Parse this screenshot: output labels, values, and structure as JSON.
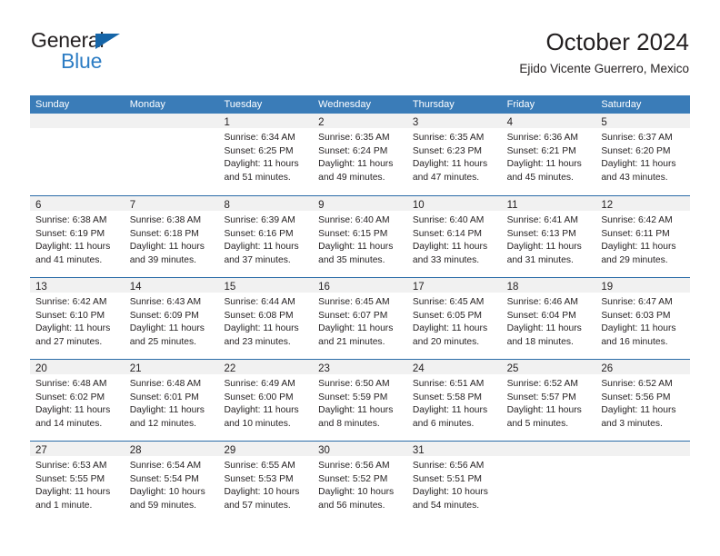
{
  "brand": {
    "name_part1": "General",
    "name_part2": "Blue",
    "triangle_color": "#1565a8",
    "blue_color": "#2d7dc4"
  },
  "header": {
    "title": "October 2024",
    "subtitle": "Ejido Vicente Guerrero, Mexico"
  },
  "theme": {
    "header_blue": "#3a7cb8",
    "row_divider": "#2a6ca8",
    "day_band_gray": "#f1f1f1",
    "text": "#231f20"
  },
  "weekdays": [
    "Sunday",
    "Monday",
    "Tuesday",
    "Wednesday",
    "Thursday",
    "Friday",
    "Saturday"
  ],
  "weeks": [
    [
      {
        "empty": true
      },
      {
        "empty": true
      },
      {
        "day": "1",
        "sunrise": "Sunrise: 6:34 AM",
        "sunset": "Sunset: 6:25 PM",
        "daylight1": "Daylight: 11 hours",
        "daylight2": "and 51 minutes."
      },
      {
        "day": "2",
        "sunrise": "Sunrise: 6:35 AM",
        "sunset": "Sunset: 6:24 PM",
        "daylight1": "Daylight: 11 hours",
        "daylight2": "and 49 minutes."
      },
      {
        "day": "3",
        "sunrise": "Sunrise: 6:35 AM",
        "sunset": "Sunset: 6:23 PM",
        "daylight1": "Daylight: 11 hours",
        "daylight2": "and 47 minutes."
      },
      {
        "day": "4",
        "sunrise": "Sunrise: 6:36 AM",
        "sunset": "Sunset: 6:21 PM",
        "daylight1": "Daylight: 11 hours",
        "daylight2": "and 45 minutes."
      },
      {
        "day": "5",
        "sunrise": "Sunrise: 6:37 AM",
        "sunset": "Sunset: 6:20 PM",
        "daylight1": "Daylight: 11 hours",
        "daylight2": "and 43 minutes."
      }
    ],
    [
      {
        "day": "6",
        "sunrise": "Sunrise: 6:38 AM",
        "sunset": "Sunset: 6:19 PM",
        "daylight1": "Daylight: 11 hours",
        "daylight2": "and 41 minutes."
      },
      {
        "day": "7",
        "sunrise": "Sunrise: 6:38 AM",
        "sunset": "Sunset: 6:18 PM",
        "daylight1": "Daylight: 11 hours",
        "daylight2": "and 39 minutes."
      },
      {
        "day": "8",
        "sunrise": "Sunrise: 6:39 AM",
        "sunset": "Sunset: 6:16 PM",
        "daylight1": "Daylight: 11 hours",
        "daylight2": "and 37 minutes."
      },
      {
        "day": "9",
        "sunrise": "Sunrise: 6:40 AM",
        "sunset": "Sunset: 6:15 PM",
        "daylight1": "Daylight: 11 hours",
        "daylight2": "and 35 minutes."
      },
      {
        "day": "10",
        "sunrise": "Sunrise: 6:40 AM",
        "sunset": "Sunset: 6:14 PM",
        "daylight1": "Daylight: 11 hours",
        "daylight2": "and 33 minutes."
      },
      {
        "day": "11",
        "sunrise": "Sunrise: 6:41 AM",
        "sunset": "Sunset: 6:13 PM",
        "daylight1": "Daylight: 11 hours",
        "daylight2": "and 31 minutes."
      },
      {
        "day": "12",
        "sunrise": "Sunrise: 6:42 AM",
        "sunset": "Sunset: 6:11 PM",
        "daylight1": "Daylight: 11 hours",
        "daylight2": "and 29 minutes."
      }
    ],
    [
      {
        "day": "13",
        "sunrise": "Sunrise: 6:42 AM",
        "sunset": "Sunset: 6:10 PM",
        "daylight1": "Daylight: 11 hours",
        "daylight2": "and 27 minutes."
      },
      {
        "day": "14",
        "sunrise": "Sunrise: 6:43 AM",
        "sunset": "Sunset: 6:09 PM",
        "daylight1": "Daylight: 11 hours",
        "daylight2": "and 25 minutes."
      },
      {
        "day": "15",
        "sunrise": "Sunrise: 6:44 AM",
        "sunset": "Sunset: 6:08 PM",
        "daylight1": "Daylight: 11 hours",
        "daylight2": "and 23 minutes."
      },
      {
        "day": "16",
        "sunrise": "Sunrise: 6:45 AM",
        "sunset": "Sunset: 6:07 PM",
        "daylight1": "Daylight: 11 hours",
        "daylight2": "and 21 minutes."
      },
      {
        "day": "17",
        "sunrise": "Sunrise: 6:45 AM",
        "sunset": "Sunset: 6:05 PM",
        "daylight1": "Daylight: 11 hours",
        "daylight2": "and 20 minutes."
      },
      {
        "day": "18",
        "sunrise": "Sunrise: 6:46 AM",
        "sunset": "Sunset: 6:04 PM",
        "daylight1": "Daylight: 11 hours",
        "daylight2": "and 18 minutes."
      },
      {
        "day": "19",
        "sunrise": "Sunrise: 6:47 AM",
        "sunset": "Sunset: 6:03 PM",
        "daylight1": "Daylight: 11 hours",
        "daylight2": "and 16 minutes."
      }
    ],
    [
      {
        "day": "20",
        "sunrise": "Sunrise: 6:48 AM",
        "sunset": "Sunset: 6:02 PM",
        "daylight1": "Daylight: 11 hours",
        "daylight2": "and 14 minutes."
      },
      {
        "day": "21",
        "sunrise": "Sunrise: 6:48 AM",
        "sunset": "Sunset: 6:01 PM",
        "daylight1": "Daylight: 11 hours",
        "daylight2": "and 12 minutes."
      },
      {
        "day": "22",
        "sunrise": "Sunrise: 6:49 AM",
        "sunset": "Sunset: 6:00 PM",
        "daylight1": "Daylight: 11 hours",
        "daylight2": "and 10 minutes."
      },
      {
        "day": "23",
        "sunrise": "Sunrise: 6:50 AM",
        "sunset": "Sunset: 5:59 PM",
        "daylight1": "Daylight: 11 hours",
        "daylight2": "and 8 minutes."
      },
      {
        "day": "24",
        "sunrise": "Sunrise: 6:51 AM",
        "sunset": "Sunset: 5:58 PM",
        "daylight1": "Daylight: 11 hours",
        "daylight2": "and 6 minutes."
      },
      {
        "day": "25",
        "sunrise": "Sunrise: 6:52 AM",
        "sunset": "Sunset: 5:57 PM",
        "daylight1": "Daylight: 11 hours",
        "daylight2": "and 5 minutes."
      },
      {
        "day": "26",
        "sunrise": "Sunrise: 6:52 AM",
        "sunset": "Sunset: 5:56 PM",
        "daylight1": "Daylight: 11 hours",
        "daylight2": "and 3 minutes."
      }
    ],
    [
      {
        "day": "27",
        "sunrise": "Sunrise: 6:53 AM",
        "sunset": "Sunset: 5:55 PM",
        "daylight1": "Daylight: 11 hours",
        "daylight2": "and 1 minute."
      },
      {
        "day": "28",
        "sunrise": "Sunrise: 6:54 AM",
        "sunset": "Sunset: 5:54 PM",
        "daylight1": "Daylight: 10 hours",
        "daylight2": "and 59 minutes."
      },
      {
        "day": "29",
        "sunrise": "Sunrise: 6:55 AM",
        "sunset": "Sunset: 5:53 PM",
        "daylight1": "Daylight: 10 hours",
        "daylight2": "and 57 minutes."
      },
      {
        "day": "30",
        "sunrise": "Sunrise: 6:56 AM",
        "sunset": "Sunset: 5:52 PM",
        "daylight1": "Daylight: 10 hours",
        "daylight2": "and 56 minutes."
      },
      {
        "day": "31",
        "sunrise": "Sunrise: 6:56 AM",
        "sunset": "Sunset: 5:51 PM",
        "daylight1": "Daylight: 10 hours",
        "daylight2": "and 54 minutes."
      },
      {
        "empty": true
      },
      {
        "empty": true
      }
    ]
  ]
}
